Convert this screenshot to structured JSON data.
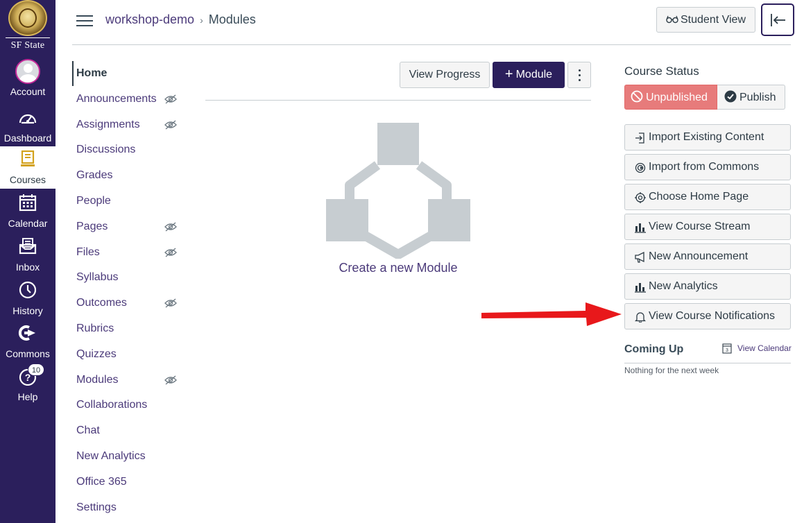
{
  "branding": {
    "wordmark": "SF State"
  },
  "global_nav": [
    {
      "label": "Account",
      "icon": "avatar"
    },
    {
      "label": "Dashboard",
      "icon": "dashboard-icon"
    },
    {
      "label": "Courses",
      "icon": "courses-icon",
      "active": true
    },
    {
      "label": "Calendar",
      "icon": "calendar-icon"
    },
    {
      "label": "Inbox",
      "icon": "inbox-icon"
    },
    {
      "label": "History",
      "icon": "history-icon"
    },
    {
      "label": "Commons",
      "icon": "commons-icon"
    },
    {
      "label": "Help",
      "icon": "help-icon",
      "badge": "10"
    }
  ],
  "header": {
    "breadcrumb": [
      "workshop-demo",
      "Modules"
    ],
    "student_view": "Student View"
  },
  "course_nav": [
    {
      "label": "Home",
      "active": true,
      "hidden": false
    },
    {
      "label": "Announcements",
      "hidden": true
    },
    {
      "label": "Assignments",
      "hidden": true
    },
    {
      "label": "Discussions",
      "hidden": false
    },
    {
      "label": "Grades",
      "hidden": false
    },
    {
      "label": "People",
      "hidden": false
    },
    {
      "label": "Pages",
      "hidden": true
    },
    {
      "label": "Files",
      "hidden": true
    },
    {
      "label": "Syllabus",
      "hidden": false
    },
    {
      "label": "Outcomes",
      "hidden": true
    },
    {
      "label": "Rubrics",
      "hidden": false
    },
    {
      "label": "Quizzes",
      "hidden": false
    },
    {
      "label": "Modules",
      "hidden": true
    },
    {
      "label": "Collaborations",
      "hidden": false
    },
    {
      "label": "Chat",
      "hidden": false
    },
    {
      "label": "New Analytics",
      "hidden": false
    },
    {
      "label": "Office 365",
      "hidden": false
    },
    {
      "label": "Settings",
      "hidden": false
    }
  ],
  "modules": {
    "view_progress": "View Progress",
    "add_module": "Module",
    "empty_text": "Create a new Module"
  },
  "sidebar": {
    "course_status_title": "Course Status",
    "unpublished": "Unpublished",
    "publish": "Publish",
    "buttons": [
      "Import Existing Content",
      "Import from Commons",
      "Choose Home Page",
      "View Course Stream",
      "New Announcement",
      "New Analytics",
      "View Course Notifications"
    ],
    "coming_up_title": "Coming Up",
    "view_calendar": "View Calendar",
    "calendar_day": "3",
    "coming_up_empty": "Nothing for the next week"
  },
  "colors": {
    "nav_bg": "#2b1f5c",
    "link": "#4b3a7a",
    "unpublished": "#e77b7b",
    "arrow": "#e8181b"
  }
}
